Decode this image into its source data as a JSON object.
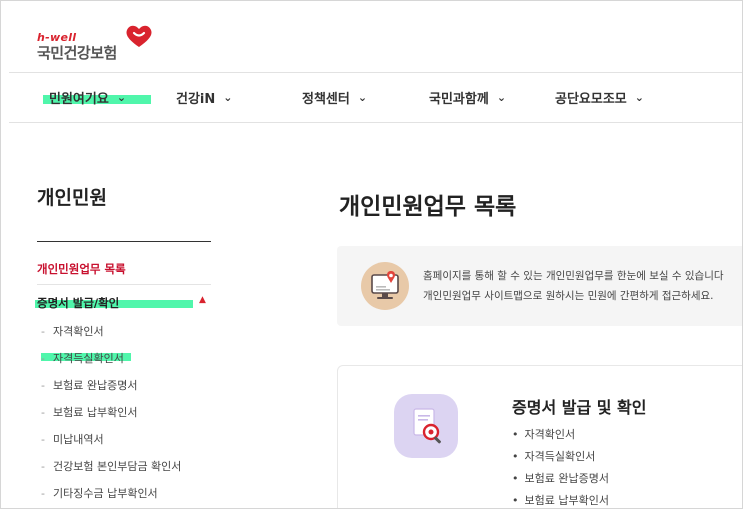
{
  "header": {
    "logo_sub": "h-well",
    "logo_main": "국민건강보험"
  },
  "nav": {
    "items": [
      {
        "label": "민원여기요"
      },
      {
        "label": "건강iN"
      },
      {
        "label": "정책센터"
      },
      {
        "label": "국민과함께"
      },
      {
        "label": "공단요모조모"
      }
    ],
    "chevron": "⌄"
  },
  "sidebar": {
    "title": "개인민원",
    "active_link": "개인민원업무 목록",
    "section": "증명서 발급/확인",
    "dash": "-",
    "items": [
      {
        "label": "자격확인서"
      },
      {
        "label": "자격득실확인서"
      },
      {
        "label": "보험료 완납증명서"
      },
      {
        "label": "보험료 납부확인서"
      },
      {
        "label": "미납내역서"
      },
      {
        "label": "건강보험 본인부담금 확인서"
      },
      {
        "label": "기타징수금 납부확인서"
      }
    ]
  },
  "main": {
    "title": "개인민원업무 목록",
    "info_lines": [
      "홈페이지를 통해 할 수 있는 개인민원업무를 한눈에 보실 수 있습니다",
      "개인민원업무 사이트맵으로 원하시는 민원에 간편하게 접근하세요."
    ],
    "card": {
      "title": "증명서 발급 및 확인",
      "bullet": "•",
      "items": [
        {
          "label": "자격확인서"
        },
        {
          "label": "자격득실확인서"
        },
        {
          "label": "보험료 완납증명서"
        },
        {
          "label": "보험료 납부확인서"
        }
      ]
    }
  },
  "colors": {
    "accent_red": "#c8102e",
    "highlight": "#3df5a2"
  }
}
